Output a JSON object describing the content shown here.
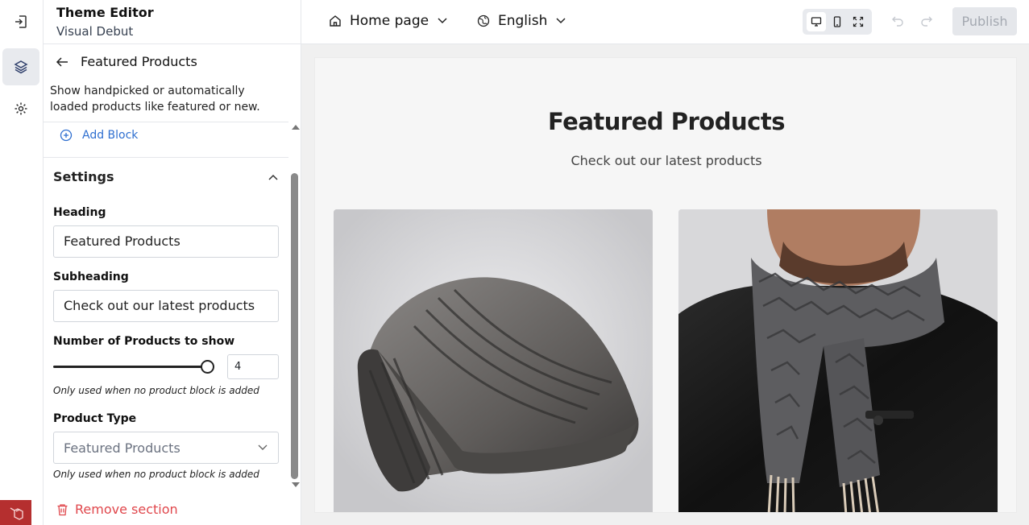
{
  "header": {
    "title": "Theme Editor",
    "subtitle": "Visual Debut"
  },
  "panel": {
    "back_label": "Featured Products",
    "description": "Show handpicked or automatically loaded products like featured or new.",
    "add_block_label": "Add Block",
    "settings_title": "Settings",
    "heading_label": "Heading",
    "heading_value": "Featured Products",
    "subheading_label": "Subheading",
    "subheading_value": "Check out our latest products",
    "count_label": "Number of Products to show",
    "count_value": "4",
    "count_fraction": 1.0,
    "count_hint": "Only used when no product block is added",
    "type_label": "Product Type",
    "type_value": "Featured Products",
    "type_hint": "Only used when no product block is added",
    "remove_label": "Remove section"
  },
  "toolbar": {
    "page_label": "Home page",
    "language_label": "English",
    "publish_label": "Publish"
  },
  "preview": {
    "title": "Featured Products",
    "subtitle": "Check out our latest products",
    "cards": [
      {
        "icon": "beanie-product-image"
      },
      {
        "icon": "scarf-product-image"
      }
    ]
  },
  "colors": {
    "accent": "#2f6fd0",
    "danger": "#e0474c",
    "logo": "#b52f2f"
  }
}
